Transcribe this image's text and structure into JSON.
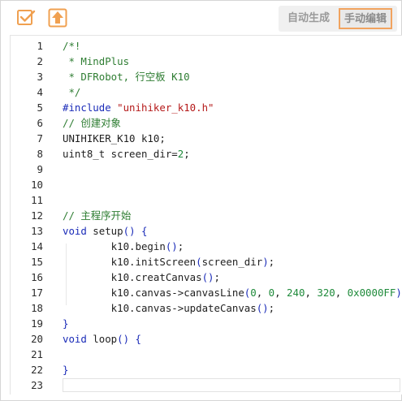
{
  "toolbar": {
    "check_icon": "checkbox-check-icon",
    "upload_icon": "upload-arrow-icon",
    "mode_auto_label": "自动生成",
    "mode_manual_label": "手动编辑",
    "accent_color": "#f0a050"
  },
  "editor": {
    "lines": [
      {
        "n": "1",
        "tokens": [
          {
            "t": "/*!",
            "c": "comment"
          }
        ]
      },
      {
        "n": "2",
        "tokens": [
          {
            "t": " * MindPlus",
            "c": "comment"
          }
        ]
      },
      {
        "n": "3",
        "tokens": [
          {
            "t": " * DFRobot, 行空板 K10",
            "c": "comment"
          }
        ]
      },
      {
        "n": "4",
        "tokens": [
          {
            "t": " */",
            "c": "comment"
          }
        ]
      },
      {
        "n": "5",
        "tokens": [
          {
            "t": "#include ",
            "c": "kw"
          },
          {
            "t": "\"unihiker_k10.h\"",
            "c": "str"
          }
        ]
      },
      {
        "n": "6",
        "tokens": [
          {
            "t": "// 创建对象",
            "c": "comment"
          }
        ]
      },
      {
        "n": "7",
        "tokens": [
          {
            "t": "UNIHIKER_K10 k10;",
            "c": "plain"
          }
        ]
      },
      {
        "n": "8",
        "tokens": [
          {
            "t": "uint8_t screen_dir=",
            "c": "plain"
          },
          {
            "t": "2",
            "c": "num"
          },
          {
            "t": ";",
            "c": "plain"
          }
        ]
      },
      {
        "n": "9",
        "tokens": []
      },
      {
        "n": "10",
        "tokens": []
      },
      {
        "n": "11",
        "tokens": []
      },
      {
        "n": "12",
        "tokens": [
          {
            "t": "// 主程序开始",
            "c": "comment"
          }
        ]
      },
      {
        "n": "13",
        "tokens": [
          {
            "t": "void",
            "c": "kw"
          },
          {
            "t": " setup",
            "c": "plain"
          },
          {
            "t": "()",
            "c": "paren"
          },
          {
            "t": " {",
            "c": "paren"
          }
        ]
      },
      {
        "n": "14",
        "tokens": [
          {
            "t": "        k10.begin",
            "c": "plain"
          },
          {
            "t": "()",
            "c": "paren"
          },
          {
            "t": ";",
            "c": "plain"
          }
        ]
      },
      {
        "n": "15",
        "tokens": [
          {
            "t": "        k10.initScreen",
            "c": "plain"
          },
          {
            "t": "(",
            "c": "paren"
          },
          {
            "t": "screen_dir",
            "c": "plain"
          },
          {
            "t": ")",
            "c": "paren"
          },
          {
            "t": ";",
            "c": "plain"
          }
        ]
      },
      {
        "n": "16",
        "tokens": [
          {
            "t": "        k10.creatCanvas",
            "c": "plain"
          },
          {
            "t": "()",
            "c": "paren"
          },
          {
            "t": ";",
            "c": "plain"
          }
        ]
      },
      {
        "n": "17",
        "tokens": [
          {
            "t": "        k10.canvas->canvasLine",
            "c": "plain"
          },
          {
            "t": "(",
            "c": "paren"
          },
          {
            "t": "0",
            "c": "num"
          },
          {
            "t": ", ",
            "c": "plain"
          },
          {
            "t": "0",
            "c": "num"
          },
          {
            "t": ", ",
            "c": "plain"
          },
          {
            "t": "240",
            "c": "num"
          },
          {
            "t": ", ",
            "c": "plain"
          },
          {
            "t": "320",
            "c": "num"
          },
          {
            "t": ", ",
            "c": "plain"
          },
          {
            "t": "0x0000FF",
            "c": "num"
          },
          {
            "t": ")",
            "c": "paren"
          },
          {
            "t": ";",
            "c": "plain"
          }
        ]
      },
      {
        "n": "18",
        "tokens": [
          {
            "t": "        k10.canvas->updateCanvas",
            "c": "plain"
          },
          {
            "t": "()",
            "c": "paren"
          },
          {
            "t": ";",
            "c": "plain"
          }
        ]
      },
      {
        "n": "19",
        "tokens": [
          {
            "t": "}",
            "c": "paren"
          }
        ]
      },
      {
        "n": "20",
        "tokens": [
          {
            "t": "void",
            "c": "kw"
          },
          {
            "t": " loop",
            "c": "plain"
          },
          {
            "t": "()",
            "c": "paren"
          },
          {
            "t": " {",
            "c": "paren"
          }
        ]
      },
      {
        "n": "21",
        "tokens": []
      },
      {
        "n": "22",
        "tokens": [
          {
            "t": "}",
            "c": "paren"
          }
        ]
      },
      {
        "n": "23",
        "tokens": []
      }
    ]
  }
}
